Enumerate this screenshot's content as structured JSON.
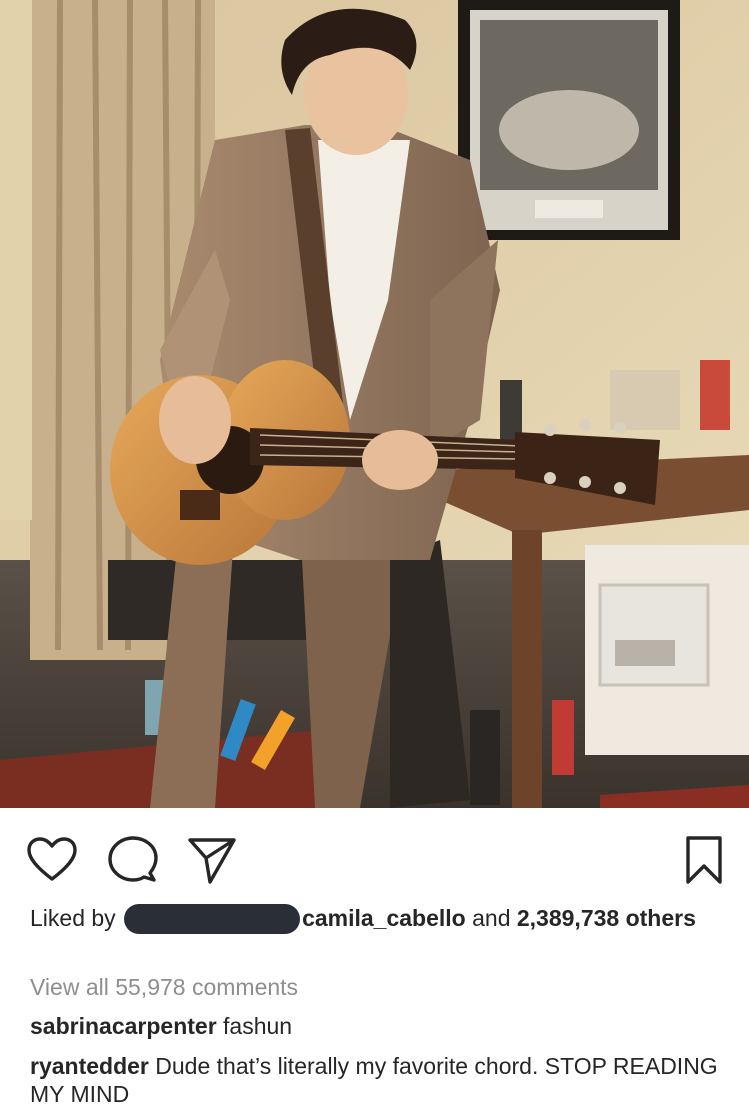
{
  "post": {
    "photo_alt": "",
    "actions": {
      "like_icon": "heart-icon",
      "comment_icon": "comment-bubble-icon",
      "share_icon": "paper-plane-icon",
      "save_icon": "bookmark-icon"
    },
    "likes": {
      "prefix": "Liked by",
      "liker": "camila_cabello",
      "connector": "and",
      "count": "2,389,738",
      "suffix": "others"
    },
    "view_all_comments": "View all 55,978 comments",
    "comments": [
      {
        "user": "sabrinacarpenter",
        "text": "fashun"
      },
      {
        "user": "ryantedder",
        "text": "Dude that’s literally my favorite chord.  STOP READING MY MIND"
      }
    ]
  },
  "colors": {
    "text": "#262626",
    "muted": "#8e8e8e",
    "redaction": "#2a2f36"
  }
}
